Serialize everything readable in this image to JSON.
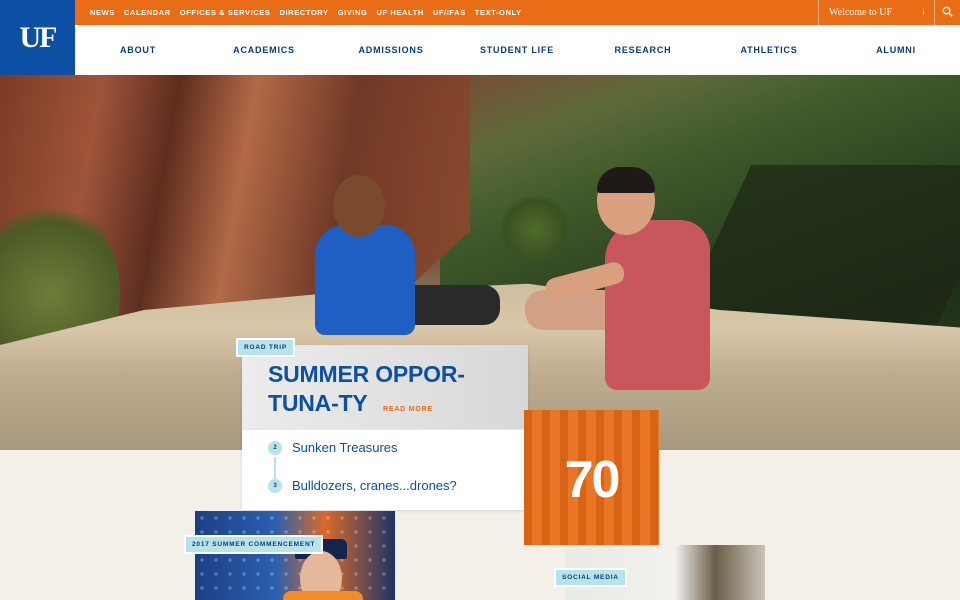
{
  "logo": {
    "text": "UF"
  },
  "utility_nav": {
    "links": [
      "News",
      "Calendar",
      "Offices & Services",
      "Directory",
      "Giving",
      "UF Health",
      "UF/IFAS",
      "Text-Only"
    ],
    "welcome_label": "Welcome to UF",
    "welcome_arrow": "↓"
  },
  "main_nav": {
    "items": [
      "ABOUT",
      "ACADEMICS",
      "ADMISSIONS",
      "STUDENT LIFE",
      "RESEARCH",
      "ATHLETICS",
      "ALUMNI"
    ]
  },
  "feature": {
    "tag": "ROAD TRIP",
    "headline": "SUMMER OPPOR-TUNA-TY",
    "read_more": "READ MORE",
    "stories": [
      {
        "num": "2",
        "title": "Sunken Treasures"
      },
      {
        "num": "3",
        "title": "Bulldozers, cranes...drones?"
      }
    ]
  },
  "tiles": {
    "anniversary_number": "70",
    "commencement_tag": "2017 SUMMER COMMENCEMENT",
    "social_tag": "SOCIAL MEDIA"
  },
  "colors": {
    "uf_orange": "#e96d17",
    "uf_blue": "#0d4fa3",
    "nav_text": "#0d3b7a",
    "tag_bg": "#b8e3ea"
  }
}
